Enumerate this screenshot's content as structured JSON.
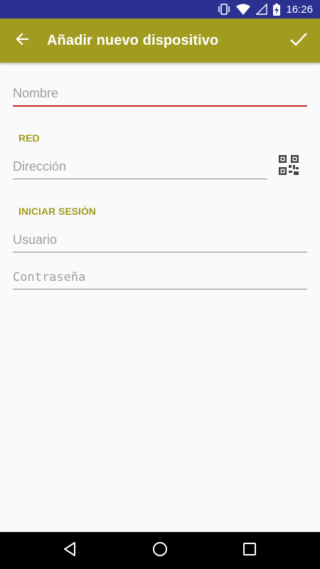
{
  "status_bar": {
    "time": "16:26",
    "background": "#2b3191",
    "icons": [
      "vibrate-icon",
      "wifi-icon",
      "cell-signal-icon",
      "battery-charging-icon"
    ]
  },
  "app_bar": {
    "title": "Añadir nuevo dispositivo",
    "background": "#a19c20",
    "back_icon": "arrow-back-icon",
    "confirm_icon": "check-icon"
  },
  "form": {
    "name": {
      "placeholder": "Nombre",
      "value": "",
      "focused": true
    },
    "network_section": "RED",
    "address": {
      "placeholder": "Dirección",
      "value": ""
    },
    "qr_icon": "qr-code-icon",
    "login_section": "INICIAR SESIÓN",
    "user": {
      "placeholder": "Usuario",
      "value": ""
    },
    "password": {
      "placeholder": "Contraseña",
      "value": ""
    }
  },
  "colors": {
    "accent": "#a19c20",
    "focus_underline": "#c62828",
    "background": "#fafafa"
  },
  "nav_bar": {
    "buttons": [
      "nav-back-icon",
      "nav-home-icon",
      "nav-recents-icon"
    ]
  }
}
